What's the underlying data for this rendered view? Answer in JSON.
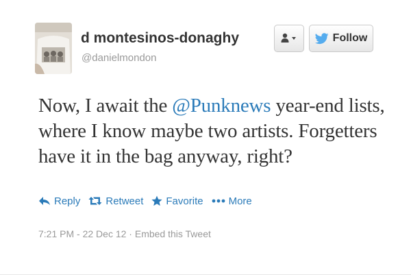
{
  "user": {
    "display_name": "d montesinos-donaghy",
    "handle": "@danielmondon"
  },
  "buttons": {
    "user_actions_icon": "user-dropdown-icon",
    "follow_label": "Follow",
    "follow_icon": "twitter-bird-icon"
  },
  "tweet": {
    "text_before": "Now, I await the ",
    "mention": "@Punknews",
    "text_after": " year-end lists, where I know maybe two artists. Forgetters have it in the bag anyway, right?"
  },
  "actions": {
    "reply": "Reply",
    "retweet": "Retweet",
    "favorite": "Favorite",
    "more": "More"
  },
  "meta": {
    "timestamp": "7:21 PM - 22 Dec 12",
    "separator": " · ",
    "embed": "Embed this Tweet"
  },
  "colors": {
    "link": "#2b7bb9",
    "twitter_blue": "#55acee",
    "text": "#333333",
    "muted": "#999999"
  }
}
